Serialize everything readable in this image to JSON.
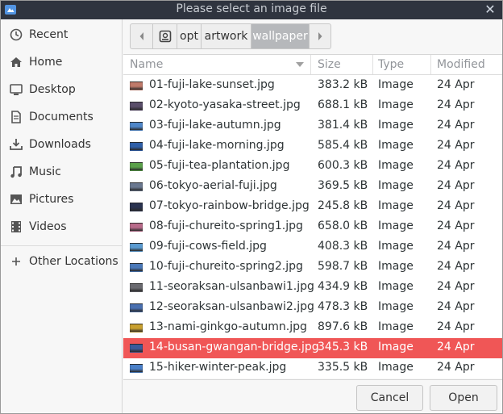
{
  "window": {
    "title": "Please select an image file",
    "accent": "#f05656",
    "titlebar_bg": "#2f343f"
  },
  "sidebar": {
    "items": [
      {
        "label": "Recent",
        "icon": "clock-icon"
      },
      {
        "label": "Home",
        "icon": "home-icon"
      },
      {
        "label": "Desktop",
        "icon": "desktop-icon"
      },
      {
        "label": "Documents",
        "icon": "document-icon"
      },
      {
        "label": "Downloads",
        "icon": "download-icon"
      },
      {
        "label": "Music",
        "icon": "music-icon"
      },
      {
        "label": "Pictures",
        "icon": "picture-icon"
      },
      {
        "label": "Videos",
        "icon": "video-icon"
      }
    ],
    "other": {
      "label": "Other Locations",
      "icon": "plus-icon"
    }
  },
  "pathbar": {
    "segments": [
      "opt",
      "artwork",
      "wallpaper"
    ]
  },
  "columns": {
    "name": "Name",
    "size": "Size",
    "type": "Type",
    "modified": "Modified"
  },
  "files": [
    {
      "name": "01-fuji-lake-sunset.jpg",
      "size": "383.2 kB",
      "type": "Image",
      "modified": "24 Apr",
      "thumb": "#c07a6a"
    },
    {
      "name": "02-kyoto-yasaka-street.jpg",
      "size": "688.1 kB",
      "type": "Image",
      "modified": "24 Apr",
      "thumb": "#5a4e6a"
    },
    {
      "name": "03-fuji-lake-autumn.jpg",
      "size": "381.4 kB",
      "type": "Image",
      "modified": "24 Apr",
      "thumb": "#4f86c8"
    },
    {
      "name": "04-fuji-lake-morning.jpg",
      "size": "585.4 kB",
      "type": "Image",
      "modified": "24 Apr",
      "thumb": "#2f5fa8"
    },
    {
      "name": "05-fuji-tea-plantation.jpg",
      "size": "600.3 kB",
      "type": "Image",
      "modified": "24 Apr",
      "thumb": "#5aa04a"
    },
    {
      "name": "06-tokyo-aerial-fuji.jpg",
      "size": "369.5 kB",
      "type": "Image",
      "modified": "24 Apr",
      "thumb": "#6a7890"
    },
    {
      "name": "07-tokyo-rainbow-bridge.jpg",
      "size": "245.8 kB",
      "type": "Image",
      "modified": "24 Apr",
      "thumb": "#2a3350"
    },
    {
      "name": "08-fuji-chureito-spring1.jpg",
      "size": "658.0 kB",
      "type": "Image",
      "modified": "24 Apr",
      "thumb": "#b86a8a"
    },
    {
      "name": "09-fuji-cows-field.jpg",
      "size": "408.3 kB",
      "type": "Image",
      "modified": "24 Apr",
      "thumb": "#5a9ad0"
    },
    {
      "name": "10-fuji-chureito-spring2.jpg",
      "size": "598.7 kB",
      "type": "Image",
      "modified": "24 Apr",
      "thumb": "#4a78b8"
    },
    {
      "name": "11-seoraksan-ulsanbawi1.jpg",
      "size": "434.9 kB",
      "type": "Image",
      "modified": "24 Apr",
      "thumb": "#6a6a70"
    },
    {
      "name": "12-seoraksan-ulsanbawi2.jpg",
      "size": "478.3 kB",
      "type": "Image",
      "modified": "24 Apr",
      "thumb": "#4a70b0"
    },
    {
      "name": "13-nami-ginkgo-autumn.jpg",
      "size": "897.6 kB",
      "type": "Image",
      "modified": "24 Apr",
      "thumb": "#c8a030"
    },
    {
      "name": "14-busan-gwangan-bridge.jpg",
      "size": "345.3 kB",
      "type": "Image",
      "modified": "24 Apr",
      "thumb": "#3a5a9a",
      "selected": true
    },
    {
      "name": "15-hiker-winter-peak.jpg",
      "size": "335.5 kB",
      "type": "Image",
      "modified": "24 Apr",
      "thumb": "#4a80c8"
    }
  ],
  "buttons": {
    "cancel": "Cancel",
    "open": "Open"
  }
}
